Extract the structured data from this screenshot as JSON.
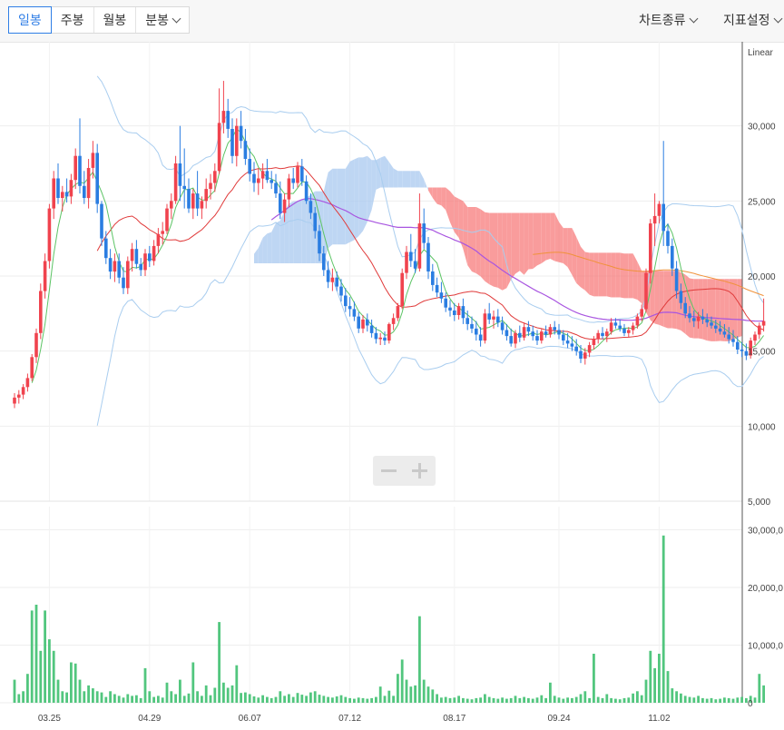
{
  "toolbar": {
    "periods": [
      "일봉",
      "주봉",
      "월봉",
      "분봉"
    ],
    "active_period": "일봉",
    "chart_type_menu": "차트종류",
    "indicator_menu": "지표설정"
  },
  "colors": {
    "up": "#f0434e",
    "down": "#2a7de1",
    "volume": "#52c67e",
    "ma5": "#5cc465",
    "ma20": "#e03a3a",
    "ma60": "#a855e0",
    "ma120": "#f0923a",
    "bollinger": "#a9cdef",
    "cloud_bear": "#f77b7b",
    "cloud_bull": "#a9c9f0"
  },
  "chart_data": {
    "type": "candlestick",
    "price_axis": {
      "scale_label": "Linear",
      "ticks": [
        5000,
        10000,
        15000,
        20000,
        25000,
        30000
      ],
      "tick_labels": [
        "5,000",
        "10,000",
        "15,000",
        "20,000",
        "25,000",
        "30,000"
      ],
      "range": [
        5000,
        35000
      ]
    },
    "volume_axis": {
      "ticks": [
        0,
        10000000,
        20000000,
        30000000
      ],
      "tick_labels": [
        "0",
        "10,000,0",
        "20,000,0",
        "30,000,0"
      ],
      "range": [
        0,
        34000000
      ]
    },
    "x_ticks": [
      {
        "label": "03.25",
        "index": 8
      },
      {
        "label": "04.29",
        "index": 31
      },
      {
        "label": "06.07",
        "index": 54
      },
      {
        "label": "07.12",
        "index": 77
      },
      {
        "label": "08.17",
        "index": 101
      },
      {
        "label": "09.24",
        "index": 125
      },
      {
        "label": "11.02",
        "index": 148
      }
    ],
    "grid": true,
    "candles": [
      [
        11500,
        12200,
        11200,
        11900,
        4000000
      ],
      [
        11900,
        12400,
        11500,
        12100,
        1500000
      ],
      [
        12100,
        12800,
        11800,
        12600,
        2000000
      ],
      [
        12600,
        13500,
        12300,
        13200,
        5000000
      ],
      [
        13200,
        14800,
        13000,
        14600,
        16000000
      ],
      [
        14600,
        16500,
        14200,
        16200,
        17000000
      ],
      [
        16200,
        19500,
        15800,
        19000,
        9000000
      ],
      [
        19000,
        21500,
        18500,
        21000,
        16000000
      ],
      [
        21000,
        24800,
        20500,
        24500,
        11000000
      ],
      [
        24500,
        27000,
        23800,
        26500,
        9000000
      ],
      [
        26500,
        27500,
        24800,
        25200,
        4000000
      ],
      [
        25200,
        26000,
        24300,
        25600,
        2000000
      ],
      [
        25600,
        26500,
        24900,
        25300,
        1800000
      ],
      [
        25300,
        26800,
        24800,
        26400,
        7000000
      ],
      [
        26400,
        28500,
        25800,
        28000,
        6800000
      ],
      [
        28000,
        30500,
        25500,
        26000,
        4000000
      ],
      [
        26000,
        27000,
        24800,
        25200,
        2000000
      ],
      [
        25200,
        27800,
        24500,
        27200,
        3000000
      ],
      [
        27200,
        29000,
        26500,
        28200,
        2500000
      ],
      [
        28200,
        28800,
        24200,
        24800,
        2000000
      ],
      [
        24800,
        25000,
        22000,
        22500,
        1800000
      ],
      [
        22500,
        23000,
        20800,
        21200,
        1000000
      ],
      [
        21200,
        21800,
        19800,
        20300,
        2000000
      ],
      [
        20300,
        21500,
        19600,
        21000,
        1500000
      ],
      [
        21000,
        21500,
        19500,
        19900,
        1200000
      ],
      [
        19900,
        20600,
        18800,
        19200,
        900000
      ],
      [
        19200,
        21300,
        18800,
        21000,
        1500000
      ],
      [
        21000,
        22200,
        20300,
        21800,
        1200000
      ],
      [
        21800,
        22400,
        20500,
        20800,
        1300000
      ],
      [
        20800,
        21200,
        20000,
        20400,
        800000
      ],
      [
        20400,
        21800,
        20000,
        21500,
        6000000
      ],
      [
        21500,
        22000,
        20600,
        21000,
        2000000
      ],
      [
        21000,
        22400,
        20700,
        22000,
        1000000
      ],
      [
        22000,
        23200,
        21500,
        22800,
        1200000
      ],
      [
        22800,
        23600,
        22100,
        23000,
        900000
      ],
      [
        23000,
        24800,
        22800,
        24500,
        3500000
      ],
      [
        24500,
        25500,
        23800,
        25000,
        2000000
      ],
      [
        25000,
        28000,
        24800,
        27500,
        1500000
      ],
      [
        27500,
        30000,
        25000,
        26000,
        4000000
      ],
      [
        26000,
        28500,
        24500,
        25800,
        1200000
      ],
      [
        25800,
        26500,
        24200,
        24500,
        1600000
      ],
      [
        24500,
        25800,
        23800,
        25500,
        7000000
      ],
      [
        25500,
        27000,
        24000,
        24500,
        2000000
      ],
      [
        24500,
        25300,
        23800,
        25000,
        1200000
      ],
      [
        25000,
        26500,
        24500,
        25800,
        3000000
      ],
      [
        25800,
        26800,
        25100,
        26200,
        1300000
      ],
      [
        26200,
        27500,
        25600,
        27000,
        2600000
      ],
      [
        27000,
        32500,
        26800,
        30200,
        14000000
      ],
      [
        30200,
        33000,
        29500,
        31000,
        3500000
      ],
      [
        31000,
        31800,
        29200,
        29800,
        2600000
      ],
      [
        29800,
        30500,
        27500,
        28000,
        3000000
      ],
      [
        28000,
        30500,
        27300,
        30000,
        6500000
      ],
      [
        30000,
        31000,
        28500,
        29000,
        1700000
      ],
      [
        29000,
        29800,
        27400,
        27800,
        1800000
      ],
      [
        27800,
        28500,
        26300,
        26800,
        1500000
      ],
      [
        26800,
        27600,
        25600,
        26200,
        1100000
      ],
      [
        26200,
        27200,
        25400,
        26500,
        900000
      ],
      [
        26500,
        27500,
        25800,
        27000,
        1300000
      ],
      [
        27000,
        27800,
        26200,
        26400,
        1000000
      ],
      [
        26400,
        27000,
        25800,
        26200,
        800000
      ],
      [
        26200,
        26800,
        25200,
        25500,
        1000000
      ],
      [
        25500,
        26300,
        23800,
        24200,
        2000000
      ],
      [
        24200,
        25500,
        23600,
        25100,
        1200000
      ],
      [
        25100,
        26800,
        24600,
        26500,
        1500000
      ],
      [
        26500,
        27200,
        25800,
        26200,
        1000000
      ],
      [
        26200,
        27600,
        25900,
        27300,
        1700000
      ],
      [
        27300,
        27800,
        26000,
        26300,
        1400000
      ],
      [
        26300,
        26700,
        24800,
        25000,
        1200000
      ],
      [
        25000,
        25500,
        23800,
        24200,
        1800000
      ],
      [
        24200,
        24600,
        22500,
        23000,
        2000000
      ],
      [
        23000,
        23400,
        21000,
        21500,
        1400000
      ],
      [
        21500,
        22000,
        20000,
        20400,
        1200000
      ],
      [
        20400,
        21000,
        19200,
        19600,
        1000000
      ],
      [
        19600,
        20500,
        19000,
        19900,
        900000
      ],
      [
        19900,
        20300,
        19000,
        19300,
        1100000
      ],
      [
        19300,
        19800,
        18300,
        18700,
        1300000
      ],
      [
        18700,
        19200,
        17600,
        18000,
        1000000
      ],
      [
        18000,
        18600,
        17300,
        17800,
        800000
      ],
      [
        17800,
        18300,
        17000,
        17300,
        700000
      ],
      [
        17300,
        17600,
        16200,
        16500,
        900000
      ],
      [
        16500,
        17400,
        16200,
        17100,
        800000
      ],
      [
        17100,
        17500,
        16300,
        16700,
        700000
      ],
      [
        16700,
        17100,
        15900,
        16200,
        800000
      ],
      [
        16200,
        16600,
        15500,
        15800,
        1000000
      ],
      [
        15800,
        16200,
        15400,
        15900,
        2800000
      ],
      [
        15900,
        16300,
        15400,
        15700,
        1200000
      ],
      [
        15700,
        16900,
        15500,
        16800,
        2100000
      ],
      [
        16800,
        17500,
        16400,
        17200,
        1200000
      ],
      [
        17200,
        18200,
        17000,
        18000,
        5000000
      ],
      [
        18000,
        20500,
        17800,
        20200,
        7500000
      ],
      [
        20200,
        22000,
        19800,
        21600,
        4000000
      ],
      [
        21600,
        22800,
        20600,
        21000,
        2800000
      ],
      [
        21000,
        21800,
        20200,
        20500,
        3000000
      ],
      [
        20500,
        25500,
        20300,
        23500,
        15000000
      ],
      [
        23500,
        24500,
        21800,
        22200,
        4000000
      ],
      [
        22200,
        22600,
        19800,
        20300,
        2800000
      ],
      [
        20300,
        20800,
        19000,
        19400,
        2300000
      ],
      [
        19400,
        19900,
        18600,
        18900,
        1500000
      ],
      [
        18900,
        19600,
        18200,
        18500,
        900000
      ],
      [
        18500,
        18900,
        17600,
        17900,
        1000000
      ],
      [
        17900,
        18400,
        17300,
        17700,
        800000
      ],
      [
        17700,
        18200,
        17000,
        17400,
        900000
      ],
      [
        17400,
        18200,
        17100,
        18000,
        1200000
      ],
      [
        18000,
        18500,
        16800,
        17200,
        800000
      ],
      [
        17200,
        17700,
        16400,
        16800,
        700000
      ],
      [
        16800,
        17300,
        16200,
        16500,
        600000
      ],
      [
        16500,
        17000,
        15700,
        16100,
        800000
      ],
      [
        16100,
        16600,
        15300,
        15700,
        900000
      ],
      [
        15700,
        17800,
        15500,
        17500,
        1500000
      ],
      [
        17500,
        18200,
        16800,
        17100,
        1000000
      ],
      [
        17100,
        17700,
        16500,
        17300,
        800000
      ],
      [
        17300,
        17800,
        16600,
        16900,
        700000
      ],
      [
        16900,
        17300,
        16100,
        16400,
        900000
      ],
      [
        16400,
        16800,
        15700,
        16000,
        700000
      ],
      [
        16000,
        16500,
        15300,
        15500,
        800000
      ],
      [
        15500,
        16400,
        15200,
        16200,
        1200000
      ],
      [
        16200,
        16700,
        15600,
        15900,
        800000
      ],
      [
        15900,
        16900,
        15700,
        16600,
        1000000
      ],
      [
        16600,
        17000,
        16000,
        16300,
        800000
      ],
      [
        16300,
        16700,
        15700,
        16000,
        700000
      ],
      [
        16000,
        16400,
        15400,
        15700,
        900000
      ],
      [
        15700,
        16500,
        15500,
        16300,
        1300000
      ],
      [
        16300,
        16700,
        15900,
        16100,
        800000
      ],
      [
        16100,
        16800,
        15900,
        16600,
        3500000
      ],
      [
        16600,
        17000,
        16100,
        16400,
        1200000
      ],
      [
        16400,
        16800,
        15800,
        16100,
        900000
      ],
      [
        16100,
        16400,
        15400,
        15700,
        700000
      ],
      [
        15700,
        16200,
        15200,
        15500,
        900000
      ],
      [
        15500,
        16000,
        15000,
        15300,
        800000
      ],
      [
        15300,
        15800,
        14700,
        15000,
        1000000
      ],
      [
        15000,
        15400,
        14200,
        14500,
        1500000
      ],
      [
        14500,
        15200,
        14100,
        14900,
        2000000
      ],
      [
        14900,
        15600,
        14600,
        15400,
        800000
      ],
      [
        15400,
        16000,
        15100,
        15800,
        8500000
      ],
      [
        15800,
        16400,
        15500,
        16200,
        1000000
      ],
      [
        16200,
        16600,
        15800,
        16000,
        800000
      ],
      [
        16000,
        16500,
        15600,
        16300,
        1500000
      ],
      [
        16300,
        17200,
        16100,
        16900,
        800000
      ],
      [
        16900,
        17200,
        16500,
        16700,
        700000
      ],
      [
        16700,
        17100,
        16300,
        16500,
        600000
      ],
      [
        16500,
        16800,
        16000,
        16200,
        800000
      ],
      [
        16200,
        16600,
        15900,
        16400,
        900000
      ],
      [
        16400,
        16900,
        16100,
        16700,
        1600000
      ],
      [
        16700,
        17500,
        16500,
        17300,
        2000000
      ],
      [
        17300,
        18100,
        17000,
        17800,
        1300000
      ],
      [
        17800,
        20500,
        17600,
        20200,
        4000000
      ],
      [
        20200,
        23800,
        19500,
        23500,
        9000000
      ],
      [
        23500,
        25500,
        22000,
        24000,
        6000000
      ],
      [
        24000,
        25000,
        23500,
        24800,
        8500000
      ],
      [
        24800,
        29000,
        22000,
        23000,
        29000000
      ],
      [
        23000,
        23500,
        21500,
        22000,
        5500000
      ],
      [
        22000,
        22500,
        20000,
        20500,
        2500000
      ],
      [
        20500,
        21000,
        18500,
        19000,
        2000000
      ],
      [
        19000,
        19500,
        17800,
        18200,
        1600000
      ],
      [
        18200,
        18600,
        17200,
        17500,
        1200000
      ],
      [
        17500,
        18000,
        16900,
        17200,
        1000000
      ],
      [
        17200,
        17700,
        16600,
        17000,
        900000
      ],
      [
        17000,
        17600,
        16500,
        17300,
        1200000
      ],
      [
        17300,
        17800,
        16800,
        17100,
        800000
      ],
      [
        17100,
        17500,
        16600,
        16900,
        700000
      ],
      [
        16900,
        17300,
        16500,
        16700,
        800000
      ],
      [
        16700,
        17100,
        16200,
        16500,
        600000
      ],
      [
        16500,
        17000,
        16100,
        16300,
        700000
      ],
      [
        16300,
        16800,
        15900,
        16100,
        900000
      ],
      [
        16100,
        16600,
        15500,
        15800,
        800000
      ],
      [
        15800,
        16400,
        15300,
        15600,
        700000
      ],
      [
        15600,
        16000,
        14800,
        15100,
        900000
      ],
      [
        15100,
        15600,
        14600,
        15000,
        1000000
      ],
      [
        15000,
        15500,
        14400,
        14700,
        800000
      ],
      [
        14700,
        15900,
        14500,
        15700,
        1200000
      ],
      [
        15700,
        16300,
        15400,
        16100,
        900000
      ],
      [
        16100,
        16900,
        15800,
        16700,
        5000000
      ],
      [
        16700,
        18500,
        16300,
        17000,
        3000000
      ]
    ],
    "series": []
  }
}
